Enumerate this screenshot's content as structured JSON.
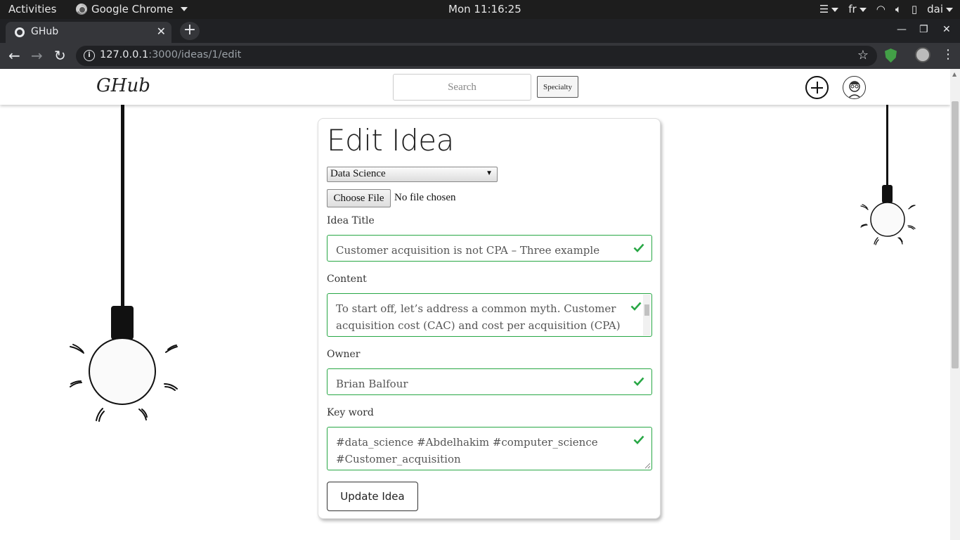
{
  "os_bar": {
    "activities": "Activities",
    "app_name": "Google Chrome",
    "clock": "Mon 11:16:25",
    "lang": "fr",
    "user": "dai"
  },
  "browser": {
    "tab_title": "GHub",
    "url_host": "127.0.0.1",
    "url_path": ":3000/ideas/1/edit"
  },
  "navbar": {
    "brand": "GHub",
    "search_placeholder": "Search",
    "specialty_label": "Specialty"
  },
  "form": {
    "heading": "Edit Idea",
    "specialty_selected": "Data Science",
    "choose_file_label": "Choose File",
    "no_file_text": "No file chosen",
    "title_label": "Idea Title",
    "title_value": "Customer acquisition is not CPA – Three example",
    "content_label": "Content",
    "content_value": "To start off, let’s address a common myth. Customer acquisition cost (CAC) and cost per acquisition (CPA)",
    "owner_label": "Owner",
    "owner_value": "Brian Balfour",
    "keyword_label": "Key word",
    "keyword_value": "#data_science #Abdelhakim #computer_science #Customer_acquisition",
    "submit_label": "Update Idea",
    "valid_color": "#28a745"
  }
}
